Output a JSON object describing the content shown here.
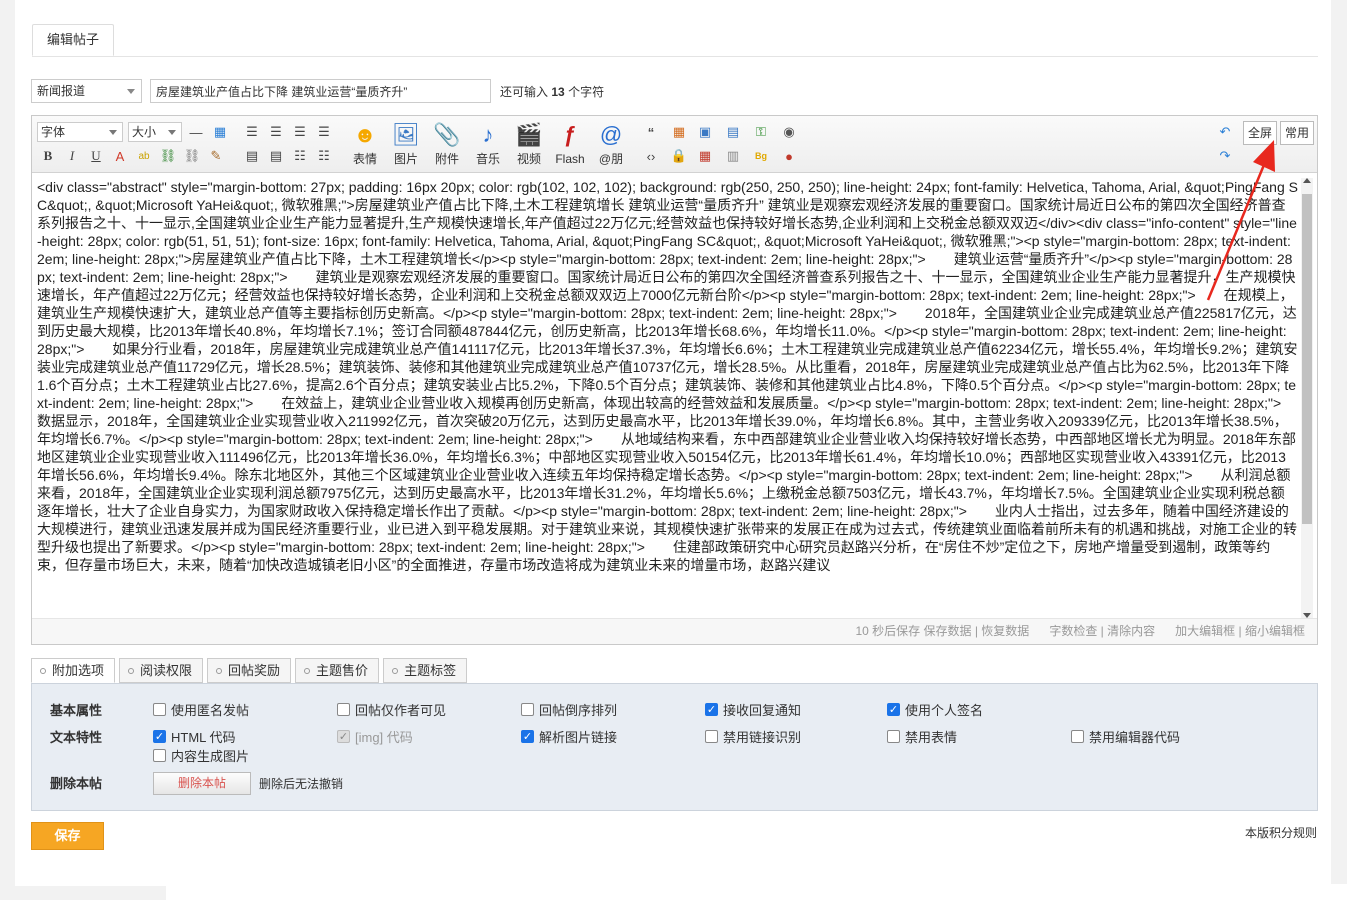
{
  "tabs": {
    "edit_post": "编辑帖子"
  },
  "title_row": {
    "category": "新闻报道",
    "title_value": "房屋建筑业产值占比下降 建筑业运营“量质齐升”",
    "remain_prefix": "还可输入",
    "remain_count": "13",
    "remain_suffix": "个字符"
  },
  "toolbar": {
    "font_label": "字体",
    "size_label": "大小",
    "big_buttons": [
      {
        "label": "表情",
        "icon": "smiley-icon"
      },
      {
        "label": "图片",
        "icon": "image-icon"
      },
      {
        "label": "附件",
        "icon": "paperclip-icon"
      },
      {
        "label": "音乐",
        "icon": "music-note-icon"
      },
      {
        "label": "视频",
        "icon": "video-icon"
      },
      {
        "label": "Flash",
        "icon": "flash-icon"
      },
      {
        "label": "@朋",
        "icon": "at-icon"
      }
    ],
    "fullscreen_label": "全屏",
    "common_label": "常用"
  },
  "editor": {
    "content": "<div class=\"abstract\" style=\"margin-bottom: 27px; padding: 16px 20px; color: rgb(102, 102, 102); background: rgb(250, 250, 250); line-height: 24px; font-family: Helvetica, Tahoma, Arial, &quot;PingFang SC&quot;, &quot;Microsoft YaHei&quot;, 微软雅黑;\">房屋建筑业产值占比下降,土木工程建筑增长 建筑业运营“量质齐升” 建筑业是观察宏观经济发展的重要窗口。国家统计局近日公布的第四次全国经济普查系列报告之十、十一显示,全国建筑业企业生产能力显著提升,生产规模快速增长,年产值超过22万亿元;经营效益也保持较好增长态势,企业利润和上交税金总额双双迈</div><div class=\"info-content\" style=\"line-height: 28px; color: rgb(51, 51, 51); font-size: 16px; font-family: Helvetica, Tahoma, Arial, &quot;PingFang SC&quot;, &quot;Microsoft YaHei&quot;, 微软雅黑;\"><p style=\"margin-bottom: 28px; text-indent: 2em; line-height: 28px;\">房屋建筑业产值占比下降，土木工程建筑增长</p><p style=\"margin-bottom: 28px; text-indent: 2em; line-height: 28px;\">　　建筑业运营“量质齐升”</p><p style=\"margin-bottom: 28px; text-indent: 2em; line-height: 28px;\">　　建筑业是观察宏观经济发展的重要窗口。国家统计局近日公布的第四次全国经济普查系列报告之十、十一显示，全国建筑业企业生产能力显著提升，生产规模快速增长，年产值超过22万亿元；经营效益也保持较好增长态势，企业利润和上交税金总额双双迈上7000亿元新台阶</p><p style=\"margin-bottom: 28px; text-indent: 2em; line-height: 28px;\">　　在规模上，建筑业生产规模快速扩大，建筑业总产值等主要指标创历史新高。</p><p style=\"margin-bottom: 28px; text-indent: 2em; line-height: 28px;\">　　2018年，全国建筑业企业完成建筑业总产值225817亿元，达到历史最大规模，比2013年增长40.8%，年均增长7.1%；签订合同额487844亿元，创历史新高，比2013年增长68.6%，年均增长11.0%。</p><p style=\"margin-bottom: 28px; text-indent: 2em; line-height: 28px;\">　　如果分行业看，2018年，房屋建筑业完成建筑业总产值141117亿元，比2013年增长37.3%，年均增长6.6%；土木工程建筑业完成建筑业总产值62234亿元，增长55.4%，年均增长9.2%；建筑安装业完成建筑业总产值11729亿元，增长28.5%；建筑装饰、装修和其他建筑业完成建筑业总产值10737亿元，增长28.5%。从比重看，2018年，房屋建筑业完成建筑业总产值占比为62.5%，比2013年下降1.6个百分点；土木工程建筑业占比27.6%，提高2.6个百分点；建筑安装业占比5.2%，下降0.5个百分点；建筑装饰、装修和其他建筑业占比4.8%，下降0.5个百分点。</p><p style=\"margin-bottom: 28px; text-indent: 2em; line-height: 28px;\">　　在效益上，建筑业企业营业收入规模再创历史新高，体现出较高的经营效益和发展质量。</p><p style=\"margin-bottom: 28px; text-indent: 2em; line-height: 28px;\">　　数据显示，2018年，全国建筑业企业实现营业收入211992亿元，首次突破20万亿元，达到历史最高水平，比2013年增长39.0%，年均增长6.8%。其中，主营业务收入209339亿元，比2013年增长38.5%，年均增长6.7%。</p><p style=\"margin-bottom: 28px; text-indent: 2em; line-height: 28px;\">　　从地域结构来看，东中西部建筑业企业营业收入均保持较好增长态势，中西部地区增长尤为明显。2018年东部地区建筑业企业实现营业收入111496亿元，比2013年增长36.0%，年均增长6.3%；中部地区实现营业收入50154亿元，比2013年增长61.4%，年均增长10.0%；西部地区实现营业收入43391亿元，比2013年增长56.6%，年均增长9.4%。除东北地区外，其他三个区域建筑业企业营业收入连续五年均保持稳定增长态势。</p><p style=\"margin-bottom: 28px; text-indent: 2em; line-height: 28px;\">　　从利润总额来看，2018年，全国建筑业企业实现利润总额7975亿元，达到历史最高水平，比2013年增长31.2%，年均增长5.6%；上缴税金总额7503亿元，增长43.7%，年均增长7.5%。全国建筑业企业实现利税总额逐年增长，壮大了企业自身实力，为国家财政收入保持稳定增长作出了贡献。</p><p style=\"margin-bottom: 28px; text-indent: 2em; line-height: 28px;\">　　业内人士指出，过去多年，随着中国经济建设的大规模进行，建筑业迅速发展并成为国民经济重要行业，业已进入到平稳发展期。对于建筑业来说，其规模快速扩张带来的发展正在成为过去式，传统建筑业面临着前所未有的机遇和挑战，对施工企业的转型升级也提出了新要求。</p><p style=\"margin-bottom: 28px; text-indent: 2em; line-height: 28px;\">　　住建部政策研究中心研究员赵路兴分析，在“房住不炒”定位之下，房地产增量受到遏制，政策等约束，但存量市场巨大，未来，随着“加快改造城镇老旧小区”的全面推进，存量市场改造将成为建筑业未来的增量市场，赵路兴建议"
  },
  "statusbar": {
    "autosave": "10 秒后保存",
    "save_data": "保存数据",
    "restore_data": "恢复数据",
    "word_check": "字数检查",
    "clear_content": "清除内容",
    "enlarge": "加大编辑框",
    "shrink": "缩小编辑框"
  },
  "option_tabs": [
    "附加选项",
    "阅读权限",
    "回帖奖励",
    "主题售价",
    "主题标签"
  ],
  "options": {
    "basic_label": "基本属性",
    "text_label": "文本特性",
    "delete_label": "删除本帖",
    "basic": [
      {
        "label": "使用匿名发帖",
        "checked": false
      },
      {
        "label": "回帖仅作者可见",
        "checked": false
      },
      {
        "label": "回帖倒序排列",
        "checked": false
      },
      {
        "label": "接收回复通知",
        "checked": true
      },
      {
        "label": "使用个人签名",
        "checked": true
      }
    ],
    "text": [
      {
        "label": "HTML 代码",
        "checked": true
      },
      {
        "label": "[img] 代码",
        "checked": true,
        "disabled": true
      },
      {
        "label": "解析图片链接",
        "checked": true
      },
      {
        "label": "禁用链接识别",
        "checked": false
      },
      {
        "label": "禁用表情",
        "checked": false
      },
      {
        "label": "禁用编辑器代码",
        "checked": false
      },
      {
        "label": "内容生成图片",
        "checked": false
      }
    ],
    "delete_button": "删除本帖",
    "delete_note": "删除后无法撤销"
  },
  "footer": {
    "save_label": "保存",
    "rules_link": "本版积分规则"
  },
  "colors": {
    "accent_save": "#f6a623",
    "annotation_arrow": "#e8281e",
    "checkbox_on": "#1a73e8"
  }
}
